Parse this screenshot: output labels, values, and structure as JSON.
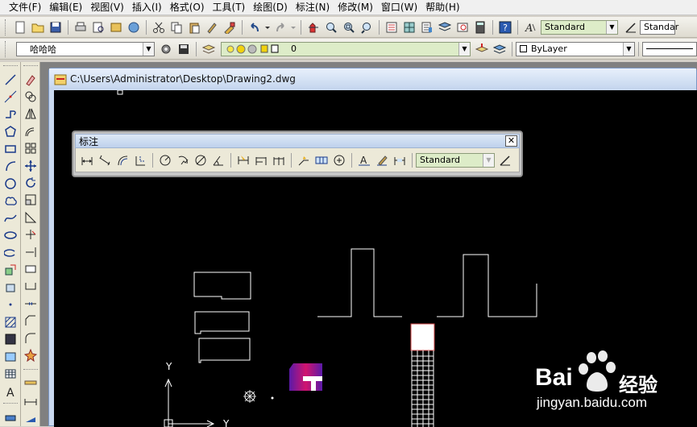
{
  "menu": [
    "文件(F)",
    "编辑(E)",
    "视图(V)",
    "插入(I)",
    "格式(O)",
    "工具(T)",
    "绘图(D)",
    "标注(N)",
    "修改(M)",
    "窗口(W)",
    "帮助(H)"
  ],
  "toolbar1": {
    "text_style_combo": "Standard",
    "dim_style_combo": "Standar"
  },
  "toolbar2": {
    "workspace_combo": "哈哈哈",
    "layer_combo": "0",
    "color_combo": "ByLayer"
  },
  "document": {
    "title": "C:\\Users\\Administrator\\Desktop\\Drawing2.dwg"
  },
  "dim_toolbar": {
    "title": "标注",
    "close": "✕",
    "style_combo": "Standard"
  },
  "ucs": {
    "y_label": "Y",
    "x_label": "Y"
  },
  "watermark": {
    "brand_a": "Bai",
    "brand_b": "经验",
    "url": "jingyan.baidu.com"
  },
  "colors": {
    "canvas": "#000000",
    "line": "#ffffff",
    "combo_green": "#ddecc8"
  }
}
